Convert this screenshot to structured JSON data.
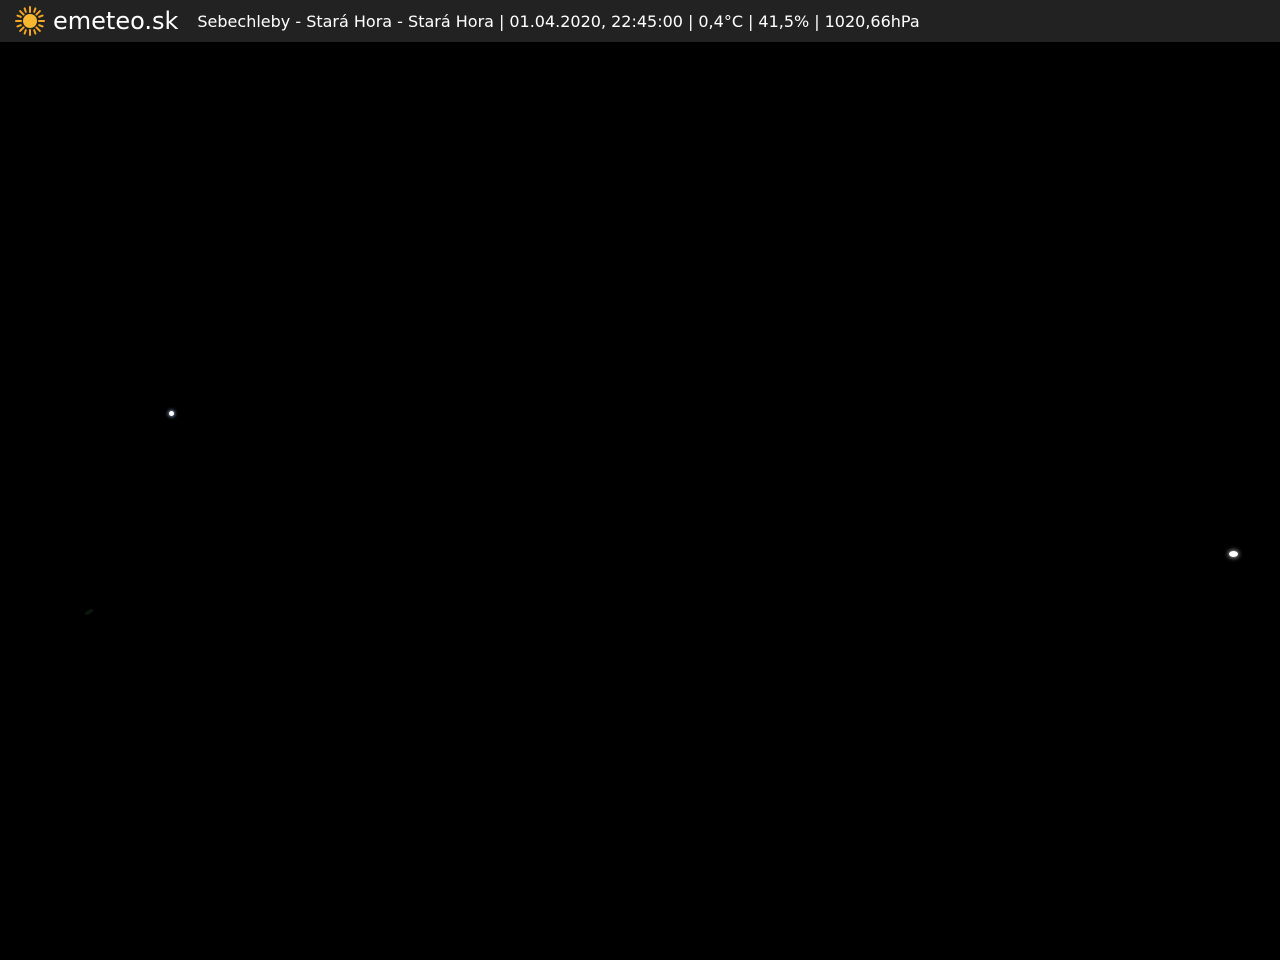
{
  "header": {
    "brand": "emeteo.sk",
    "logo_icon": "sun-icon",
    "location": "Sebechleby - Stará Hora - Stará Hora",
    "datetime": "01.04.2020, 22:45:00",
    "temperature": "0,4°C",
    "humidity": "41,5%",
    "pressure": "1020,66hPa",
    "separator": "|"
  },
  "colors": {
    "bar_background": "#222222",
    "text": "#ffffff",
    "sun": "#f5a623",
    "scene": "#000000"
  }
}
